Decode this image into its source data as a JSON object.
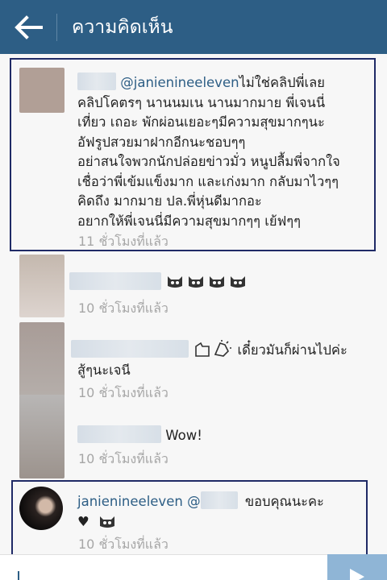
{
  "header": {
    "title": "ความคิดเห็น"
  },
  "comments": [
    {
      "mention": "@janienineeleven",
      "lines": [
        "ไม่ใช่คลิปพี่เลย",
        "คลิปโคตรๆ นานนมเน นานมากมาย พี่เจนนี่",
        "เที่ยว เถอะ พักผ่อนเยอะๆมีความสุขมากๆนะ",
        "อัฟรูปสวยมาฝากอีกนะชอบๆๆ",
        "อย่าสนใจพวกนักปล่อยข่าวมั่ว หนูปลื้มพี่จากใจ",
        "เชื่อว่าพี่เข้มแข็งมาก และเก่งมาก กลับมาไวๆๆ",
        "คิดถึง มากมาย ปล.พี่หุ่นดีมากอะ",
        "อยากให้พี่เจนนี่มีความสุขมากๆๆ เย้ฟๆๆ"
      ],
      "time": "11 ชั่วโมงที่แล้ว"
    },
    {
      "text": "",
      "time": "10 ชั่วโมงที่แล้ว"
    },
    {
      "text": "เดี๋ยวมันก็ผ่านไปค่ะ",
      "line2": "สู้ๆนะเจนี",
      "time": "10 ชั่วโมงที่แล้ว"
    },
    {
      "text": "Wow!",
      "time": "10 ชั่วโมงที่แล้ว"
    },
    {
      "username": "janienineeleven",
      "at": "@",
      "text": "ขอบคุณนะคะ",
      "line2": "♥",
      "time": "10 ชั่วโมงที่แล้ว"
    }
  ],
  "input": {
    "placeholder": ""
  },
  "colors": {
    "header": "#2d5e85",
    "accent": "#2d5e85",
    "highlight": "#1f2a66"
  },
  "icons": [
    "back-arrow-icon",
    "cat-face-icon",
    "clap-icon",
    "send-icon"
  ]
}
